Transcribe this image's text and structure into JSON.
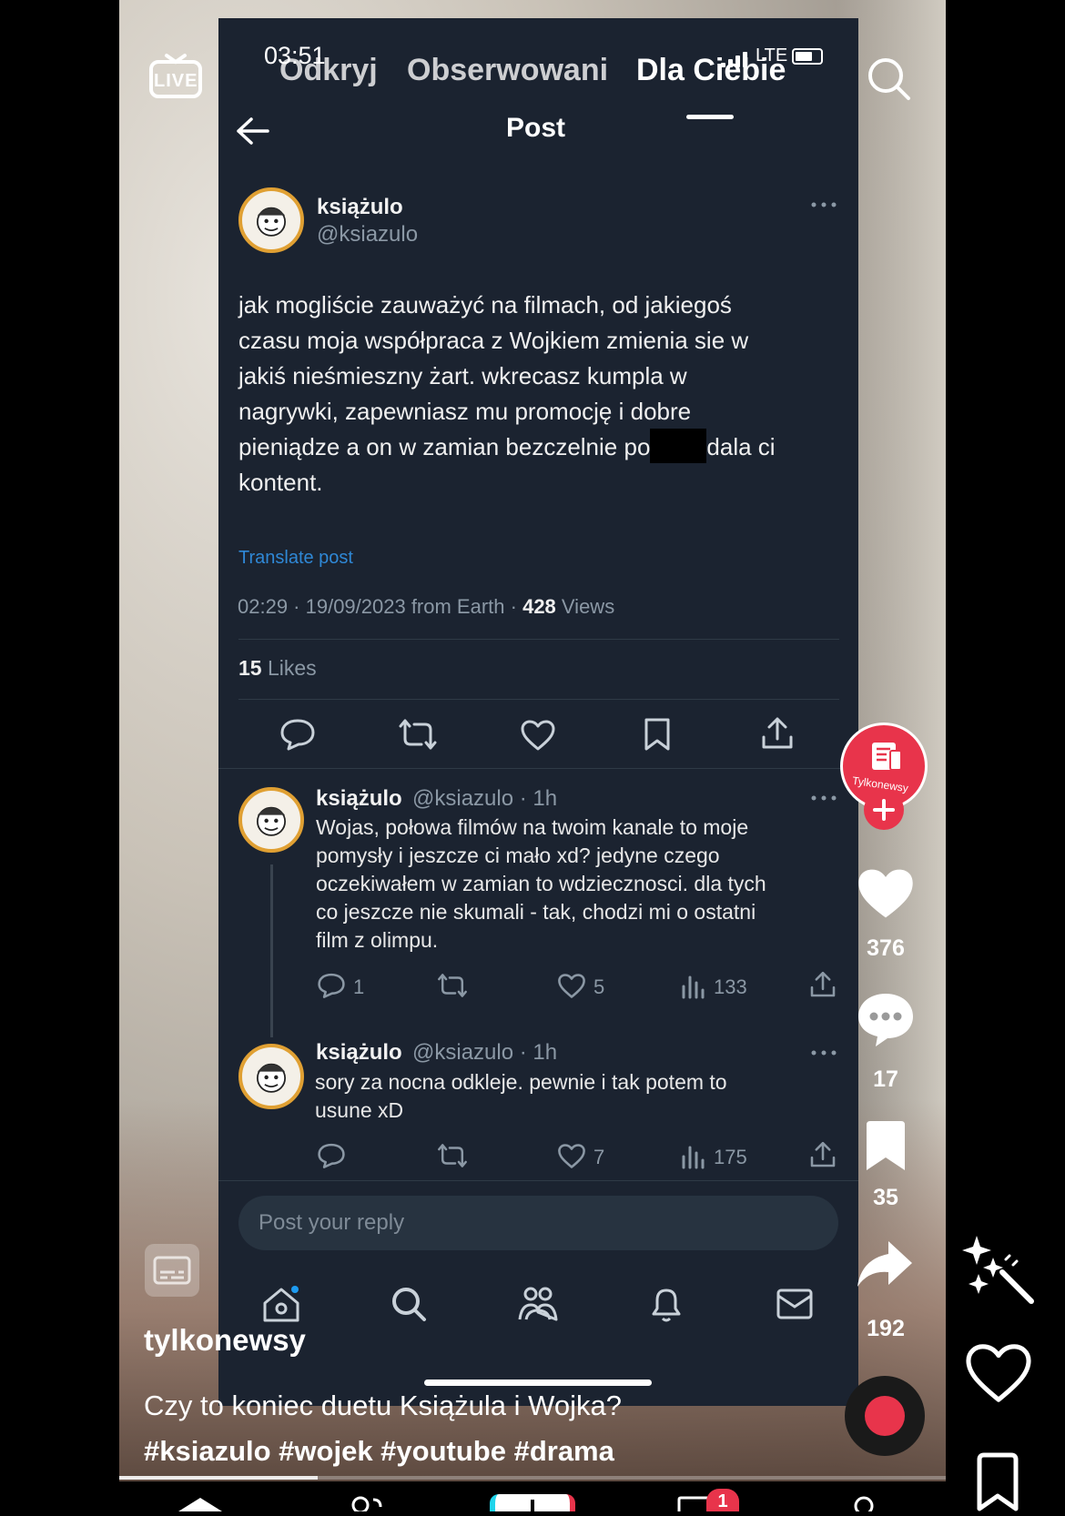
{
  "status_bar": {
    "time": "03:51",
    "network": "LTE"
  },
  "top_tabs": [
    {
      "label": "Odkryj"
    },
    {
      "label": "Obserwowani"
    },
    {
      "label": "Dla Ciebie",
      "active": true
    }
  ],
  "post_header": {
    "title": "Post"
  },
  "main_post": {
    "author": "książulo",
    "handle": "@ksiazulo",
    "lines": [
      "jak mogliście zauważyć na filmach, od jakiegoś",
      "czasu moja współpraca z Wojkiem zmienia sie w",
      "jakiś nieśmieszny żart. wkrecasz kumpla w",
      "nagrywki, zapewniasz mu promocję i dobre"
    ],
    "line5_start": "pieniądze a on w zamian bezczelnie po",
    "line5_end": "dala ci",
    "line6": "kontent.",
    "translate": "Translate post",
    "meta_prefix": "02:29 · 19/09/2023 from Earth · ",
    "views_count": "428",
    "views_label": " Views",
    "likes_count": "15",
    "likes_label": " Likes"
  },
  "replies": [
    {
      "author": "książulo",
      "handle_time": "@ksiazulo · 1h",
      "lines": [
        "Wojas, połowa filmów na twoim kanale to moje",
        "pomysły i jeszcze ci mało xd? jedyne czego",
        "oczekiwałem w zamian to wdziecznosci. dla tych",
        "co jeszcze nie skumali - tak, chodzi mi o ostatni",
        "film z olimpu."
      ],
      "comments": "1",
      "likes": "5",
      "views": "133"
    },
    {
      "author": "książulo",
      "handle_time": "@ksiazulo · 1h",
      "lines": [
        "sory za nocna odkleje. pewnie i tak potem to",
        "usune xD"
      ],
      "likes": "7",
      "views": "175"
    }
  ],
  "reply_box": {
    "placeholder": "Post your reply"
  },
  "tiktok": {
    "live_label": "LIVE",
    "profile_label": "Tylkonewsy",
    "like_count": "376",
    "comment_count": "17",
    "bookmark_count": "35",
    "share_count": "192",
    "username": "tylkonewsy",
    "caption": "Czy to koniec duetu Książula i Wojka?",
    "hashtags": "#ksiazulo #wojek #youtube #drama",
    "inbox_badge": "1",
    "progress_fraction": 0.24
  },
  "colors": {
    "twitter_bg": "#1b2330",
    "link_blue": "#2f88d6",
    "tiktok_red": "#e8344b",
    "avatar_ring": "#e0a033"
  }
}
